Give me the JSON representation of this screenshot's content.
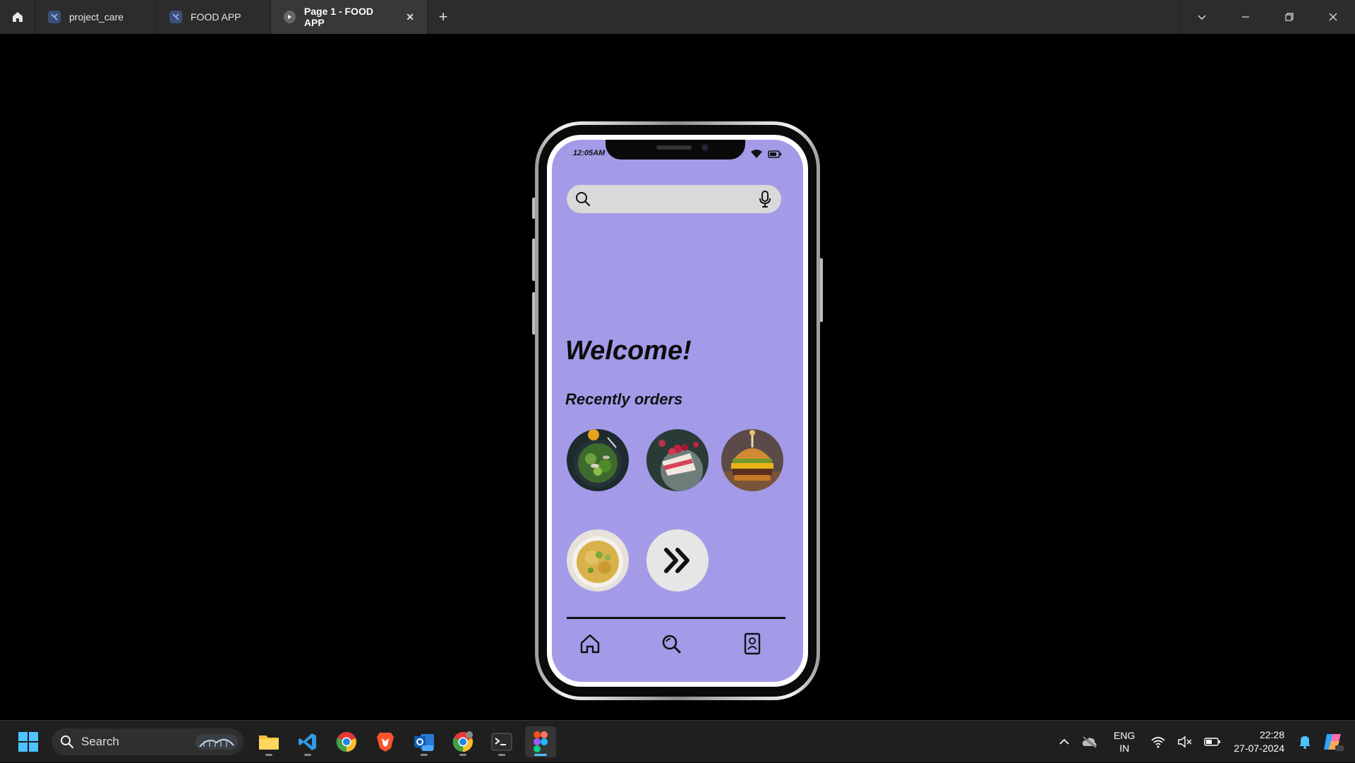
{
  "titlebar": {
    "tabs": [
      {
        "label": "project_care",
        "active": false
      },
      {
        "label": "FOOD APP",
        "active": false
      },
      {
        "label": "Page 1 - FOOD APP",
        "active": true
      }
    ],
    "close_glyph": "✕",
    "new_tab_glyph": "+"
  },
  "phone": {
    "status_time": "12:05AM",
    "search": {
      "placeholder": ""
    },
    "welcome": "Welcome!",
    "recent_title": "Recently  orders",
    "foods": [
      {
        "name": "salad",
        "color": "#3b5e34"
      },
      {
        "name": "cake",
        "color": "#c9a8a2"
      },
      {
        "name": "burger",
        "color": "#b06a2c"
      },
      {
        "name": "fried-rice",
        "color": "#d9b14a"
      }
    ],
    "nav": [
      "home-icon",
      "search-icon",
      "profile-icon"
    ],
    "screen_color": "#a39be8"
  },
  "taskbar": {
    "search_label": "Search",
    "lang_line1": "ENG",
    "lang_line2": "IN",
    "time": "22:28",
    "date": "27-07-2024"
  }
}
